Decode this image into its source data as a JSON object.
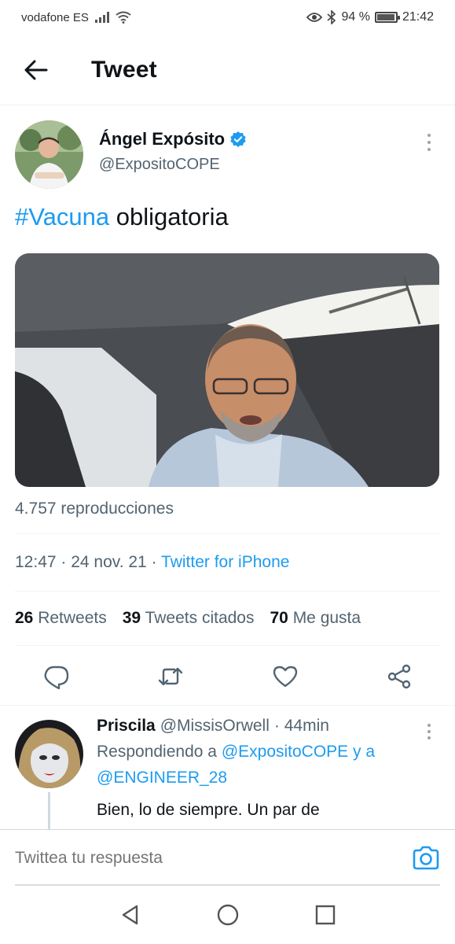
{
  "status_bar": {
    "carrier": "vodafone ES",
    "battery": "94 %",
    "battery_level": 0.94,
    "time": "21:42"
  },
  "header": {
    "title": "Tweet"
  },
  "tweet": {
    "author_name": "Ángel Expósito",
    "author_handle": "@ExpositoCOPE",
    "hashtag": "#Vacuna",
    "text_rest": " obligatoria",
    "views": "4.757 reproducciones",
    "time": "12:47 · 24 nov. 21 · ",
    "source": "Twitter for iPhone",
    "stats": {
      "retweets_count": "26",
      "retweets_label": "Retweets",
      "quotes_count": "39",
      "quotes_label": "Tweets citados",
      "likes_count": "70",
      "likes_label": "Me gusta"
    }
  },
  "reply": {
    "name": "Priscila",
    "handle": "@MissisOrwell",
    "time": "· 44min",
    "replying_prefix": "Respondiendo a",
    "mention_1": "@ExpositoCOPE",
    "replying_conj": " y a",
    "mention_2": "@ENGINEER_28",
    "text": "Bien, lo de siempre. Un par de"
  },
  "compose": {
    "placeholder": "Twittea tu respuesta"
  },
  "colors": {
    "accent": "#1d9bf0",
    "text": "#0f1419",
    "secondary": "#536471"
  }
}
